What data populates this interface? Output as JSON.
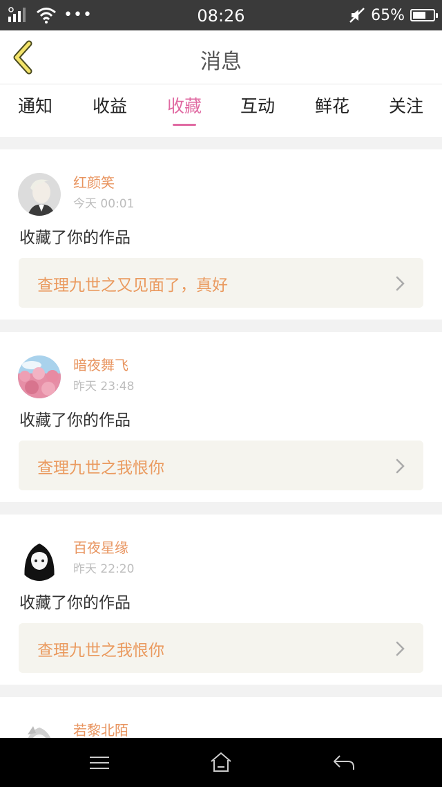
{
  "status_bar": {
    "time": "08:26",
    "battery": "65%",
    "battery_level": 0.65,
    "icons": [
      "signal-icon",
      "wifi-icon",
      "more-dots-icon",
      "mute-icon",
      "battery-icon"
    ],
    "dots": "•••"
  },
  "header": {
    "title": "消息",
    "back_icon": "chevron-left-icon"
  },
  "tabs": [
    {
      "label": "通知"
    },
    {
      "label": "收益"
    },
    {
      "label": "收藏",
      "active": true
    },
    {
      "label": "互动"
    },
    {
      "label": "鲜花"
    },
    {
      "label": "关注"
    }
  ],
  "messages": [
    {
      "user": "红颜笑",
      "time": "今天 00:01",
      "action": "收藏了你的作品",
      "work": "查理九世之又见面了，真好",
      "avatar": "avatar-boy-icon"
    },
    {
      "user": "暗夜舞飞",
      "time": "昨天 23:48",
      "action": "收藏了你的作品",
      "work": "查理九世之我恨你",
      "avatar": "avatar-blossom-icon"
    },
    {
      "user": "百夜星缘",
      "time": "昨天 22:20",
      "action": "收藏了你的作品",
      "work": "查理九世之我恨你",
      "avatar": "avatar-girl-icon"
    },
    {
      "user": "若黎北陌",
      "avatar": "avatar-girl2-icon"
    }
  ],
  "colors": {
    "accent_pink": "#e06aa2",
    "username_orange": "#e8945f",
    "work_text": "#ea9a5f",
    "work_bg": "#f5f4ee",
    "status_bar": "#3a3a3a"
  },
  "navbar": {
    "icons": [
      "menu-icon",
      "home-icon",
      "back-arrow-icon"
    ]
  }
}
